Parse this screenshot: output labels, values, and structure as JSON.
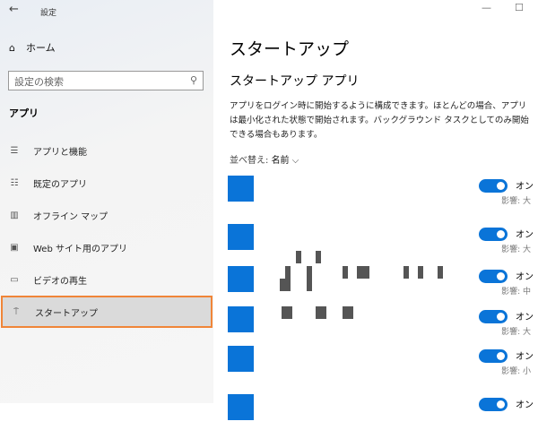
{
  "window": {
    "title": "設定",
    "back": "←",
    "minimize": "—",
    "maximize": "☐"
  },
  "sidebar": {
    "home": "ホーム",
    "search_placeholder": "設定の検索",
    "section": "アプリ",
    "items": [
      {
        "label": "アプリと機能",
        "icon": "☰"
      },
      {
        "label": "既定のアプリ",
        "icon": "☷"
      },
      {
        "label": "オフライン マップ",
        "icon": "▥"
      },
      {
        "label": "Web サイト用のアプリ",
        "icon": "▣"
      },
      {
        "label": "ビデオの再生",
        "icon": "▭"
      },
      {
        "label": "スタートアップ",
        "icon": "⍑"
      }
    ]
  },
  "main": {
    "title": "スタートアップ",
    "subtitle": "スタートアップ アプリ",
    "description": "アプリをログイン時に開始するように構成できます。ほとんどの場合、アプリは最小化された状態で開始されます。バックグラウンド タスクとしてのみ開始できる場合もあります。",
    "sort_label": "並べ替え:",
    "sort_value": "名前",
    "apps": [
      {
        "state": "オン",
        "impact": "影響: 大"
      },
      {
        "state": "オン",
        "impact": "影響: 大"
      },
      {
        "state": "オン",
        "impact": "影響: 中"
      },
      {
        "state": "オン",
        "impact": "影響: 大"
      },
      {
        "state": "オン",
        "impact": "影響: 小"
      },
      {
        "state": "オン",
        "impact": ""
      }
    ]
  },
  "colors": {
    "accent": "#0a74d8",
    "highlight": "#f08538"
  }
}
